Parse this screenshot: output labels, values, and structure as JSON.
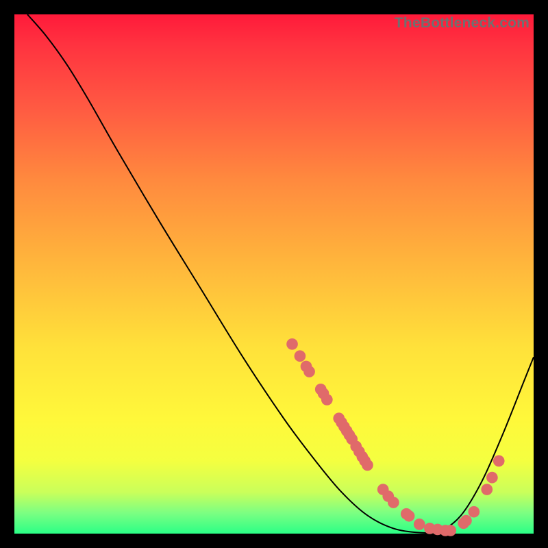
{
  "attribution": "TheBottleneck.com",
  "chart_data": {
    "type": "line",
    "title": "",
    "xlabel": "",
    "ylabel": "",
    "xlim": [
      0,
      100
    ],
    "ylim": [
      0,
      100
    ],
    "curve_points": [
      {
        "x": 2.5,
        "y": 100
      },
      {
        "x": 6,
        "y": 96
      },
      {
        "x": 10,
        "y": 90.5
      },
      {
        "x": 14,
        "y": 84
      },
      {
        "x": 20,
        "y": 73.5
      },
      {
        "x": 28,
        "y": 60
      },
      {
        "x": 36,
        "y": 47
      },
      {
        "x": 44,
        "y": 34
      },
      {
        "x": 52,
        "y": 22
      },
      {
        "x": 58,
        "y": 14
      },
      {
        "x": 63,
        "y": 8
      },
      {
        "x": 68,
        "y": 3.5
      },
      {
        "x": 73,
        "y": 1
      },
      {
        "x": 78,
        "y": 0.2
      },
      {
        "x": 82,
        "y": 0.5
      },
      {
        "x": 86,
        "y": 3.5
      },
      {
        "x": 90,
        "y": 10
      },
      {
        "x": 94,
        "y": 19
      },
      {
        "x": 98,
        "y": 29
      },
      {
        "x": 100,
        "y": 34
      }
    ],
    "markers": [
      {
        "x": 53.5,
        "y": 36.5
      },
      {
        "x": 55.0,
        "y": 34.2
      },
      {
        "x": 56.2,
        "y": 32.2
      },
      {
        "x": 56.8,
        "y": 31.2
      },
      {
        "x": 59.0,
        "y": 27.8
      },
      {
        "x": 59.5,
        "y": 27.0
      },
      {
        "x": 60.2,
        "y": 25.8
      },
      {
        "x": 62.5,
        "y": 22.2
      },
      {
        "x": 63.0,
        "y": 21.4
      },
      {
        "x": 63.5,
        "y": 20.6
      },
      {
        "x": 64.0,
        "y": 19.8
      },
      {
        "x": 64.5,
        "y": 19.0
      },
      {
        "x": 65.0,
        "y": 18.2
      },
      {
        "x": 65.8,
        "y": 16.8
      },
      {
        "x": 66.4,
        "y": 15.8
      },
      {
        "x": 67.0,
        "y": 14.8
      },
      {
        "x": 67.5,
        "y": 14.0
      },
      {
        "x": 68.0,
        "y": 13.2
      },
      {
        "x": 71.0,
        "y": 8.5
      },
      {
        "x": 72.0,
        "y": 7.2
      },
      {
        "x": 73.0,
        "y": 6.0
      },
      {
        "x": 75.5,
        "y": 3.8
      },
      {
        "x": 76.0,
        "y": 3.4
      },
      {
        "x": 78.0,
        "y": 1.8
      },
      {
        "x": 80.0,
        "y": 1.0
      },
      {
        "x": 81.5,
        "y": 0.8
      },
      {
        "x": 83.0,
        "y": 0.6
      },
      {
        "x": 84.0,
        "y": 0.6
      },
      {
        "x": 86.5,
        "y": 2.0
      },
      {
        "x": 87.0,
        "y": 2.5
      },
      {
        "x": 88.5,
        "y": 4.2
      },
      {
        "x": 91.0,
        "y": 8.5
      },
      {
        "x": 92.0,
        "y": 10.8
      },
      {
        "x": 93.3,
        "y": 14.0
      }
    ],
    "marker_radius": 1.1,
    "gradient_stops": [
      {
        "pos": 0,
        "color": "#ff1a3a"
      },
      {
        "pos": 50,
        "color": "#ffd23a"
      },
      {
        "pos": 100,
        "color": "#2bff86"
      }
    ]
  }
}
